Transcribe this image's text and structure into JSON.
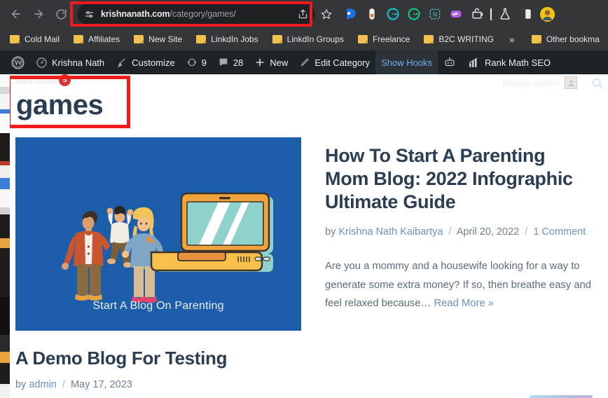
{
  "browser": {
    "nav": {
      "back": "Back",
      "forward": "Forward",
      "reload": "Reload"
    },
    "omnibox": {
      "site_info_icon": "tune-icon",
      "domain": "krishnanath.com",
      "path": "/category/games/",
      "share_icon": "share-icon",
      "bookmark_icon": "star-icon"
    },
    "extensions": [
      {
        "name": "extension-blue-d",
        "glyph": "D"
      },
      {
        "name": "extension-capsule",
        "glyph": ""
      },
      {
        "name": "extension-grammarly",
        "glyph": "G"
      },
      {
        "name": "extension-grammarly-green",
        "glyph": "G"
      },
      {
        "name": "extension-notion-dashed",
        "glyph": "N"
      },
      {
        "name": "extension-purple-pill",
        "glyph": ""
      },
      {
        "name": "extension-pot",
        "glyph": ""
      },
      {
        "name": "extension-flask",
        "glyph": ""
      },
      {
        "name": "extension-split-panel",
        "glyph": ""
      },
      {
        "name": "profile-avatar",
        "glyph": ""
      }
    ],
    "annotation_url_box_color": "#f21b1b"
  },
  "bookmarks": {
    "items": [
      {
        "label": "Cold Mail"
      },
      {
        "label": "Affiliates"
      },
      {
        "label": "New Site"
      },
      {
        "label": "LinkdIn Jobs"
      },
      {
        "label": "LinkdIn Groups"
      },
      {
        "label": "Freelance"
      },
      {
        "label": "B2C WRITING"
      }
    ],
    "overflow": "»",
    "other": {
      "label": "Other bookma"
    }
  },
  "adminbar": {
    "logo": "wordpress-logo",
    "site_name": "Krishna Nath",
    "customize": "Customize",
    "updates_count": "9",
    "comments_count": "28",
    "new": "New",
    "edit_category": "Edit Category",
    "show_hooks": "Show Hooks",
    "rank_math": "Rank Math SEO"
  },
  "page": {
    "ghost_plugin": "WPForms",
    "ghost_badge": "5",
    "howdy": "Howdy, admin",
    "category_title": "games",
    "annotation_title_box_color": "#f21b1b",
    "posts": [
      {
        "thumb_caption": "Start A Blog On Parenting",
        "thumb_bg": "#1d5eaa",
        "title": "How To Start A Parenting Mom Blog: 2022 Infographic Ultimate Guide",
        "by": "by",
        "author": "Krishna Nath Kaibartya",
        "date": "April 20, 2022",
        "comments": "1 Comment",
        "excerpt": "Are you a mommy and a housewife looking for a way to generate some extra money? If so, then breathe easy and feel relaxed because… ",
        "read_more": "Read More »"
      },
      {
        "title": "A Demo Blog For Testing",
        "by": "by",
        "author": "admin",
        "date": "May 17, 2023"
      }
    ]
  }
}
